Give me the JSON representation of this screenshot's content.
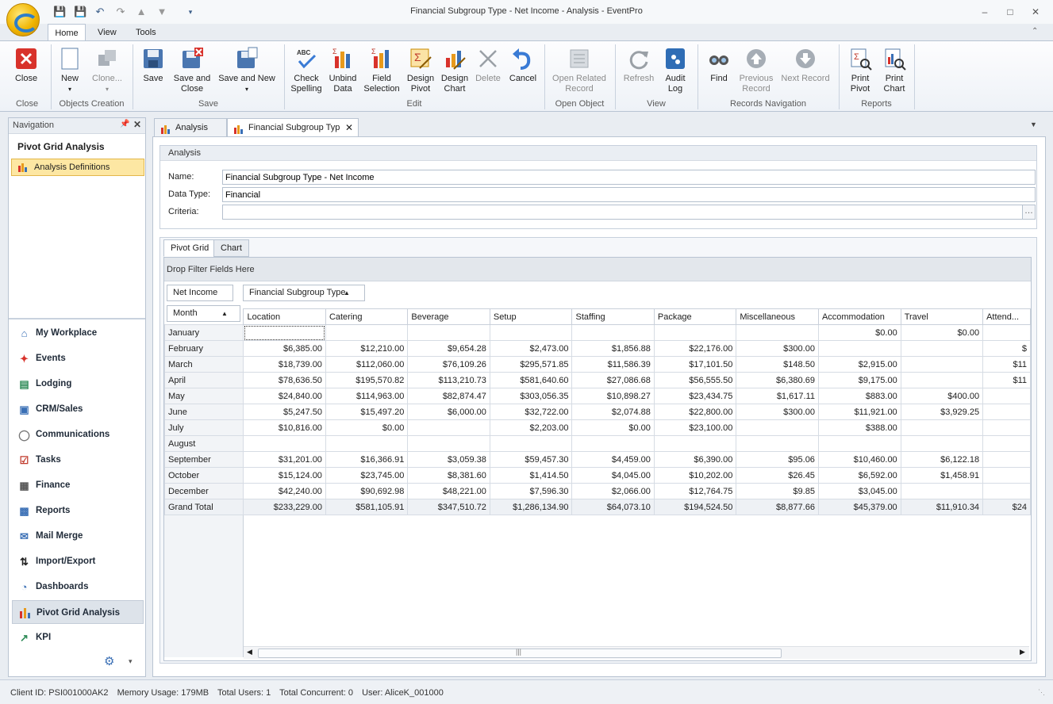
{
  "window": {
    "title": "Financial Subgroup Type - Net Income - Analysis - EventPro"
  },
  "ribbon_tabs": [
    "Home",
    "View",
    "Tools"
  ],
  "ribbon": {
    "close": "Close",
    "new": "New",
    "clone": "Clone...",
    "save": "Save",
    "save_and_close": [
      "Save and",
      "Close"
    ],
    "save_and_new": "Save and New",
    "check_spelling": [
      "Check",
      "Spelling"
    ],
    "unbind_data": [
      "Unbind",
      "Data"
    ],
    "field_selection": [
      "Field",
      "Selection"
    ],
    "design_pivot": [
      "Design",
      "Pivot"
    ],
    "design_chart": [
      "Design",
      "Chart"
    ],
    "delete": "Delete",
    "cancel": "Cancel",
    "open_related_record": [
      "Open Related",
      "Record"
    ],
    "refresh": "Refresh",
    "audit_log": [
      "Audit",
      "Log"
    ],
    "find": "Find",
    "previous_record": [
      "Previous",
      "Record"
    ],
    "next_record": "Next Record",
    "print_pivot": [
      "Print",
      "Pivot"
    ],
    "print_chart": [
      "Print",
      "Chart"
    ],
    "groups": [
      "Close",
      "Objects Creation",
      "Save",
      "Edit",
      "Open Object",
      "View",
      "Records Navigation",
      "Reports"
    ]
  },
  "navigation": {
    "header": "Navigation",
    "section_title": "Pivot Grid Analysis",
    "selected_item": "Analysis Definitions",
    "items": [
      "My Workplace",
      "Events",
      "Lodging",
      "CRM/Sales",
      "Communications",
      "Tasks",
      "Finance",
      "Reports",
      "Mail Merge",
      "Import/Export",
      "Dashboards",
      "Pivot Grid Analysis",
      "KPI"
    ]
  },
  "doc_tabs": [
    "Analysis",
    "Financial Subgroup Typ"
  ],
  "analysis": {
    "header": "Analysis",
    "name_label": "Name:",
    "name_value": "Financial Subgroup Type - Net Income",
    "data_type_label": "Data Type:",
    "data_type_value": "Financial",
    "criteria_label": "Criteria:",
    "criteria_value": ""
  },
  "pivot": {
    "tabs": [
      "Pivot Grid",
      "Chart"
    ],
    "filter_area": "Drop Filter Fields Here",
    "data_field": "Net Income",
    "column_field": "Financial Subgroup Type",
    "row_field": "Month",
    "columns": [
      "Location",
      "Catering",
      "Beverage",
      "Setup",
      "Staffing",
      "Package",
      "Miscellaneous",
      "Accommodation",
      "Travel",
      "Attend..."
    ],
    "rows": [
      {
        "month": "January",
        "values": [
          "",
          "",
          "",
          "",
          "",
          "",
          "",
          "$0.00",
          "$0.00",
          ""
        ]
      },
      {
        "month": "February",
        "values": [
          "$6,385.00",
          "$12,210.00",
          "$9,654.28",
          "$2,473.00",
          "$1,856.88",
          "$22,176.00",
          "$300.00",
          "",
          "",
          "$"
        ]
      },
      {
        "month": "March",
        "values": [
          "$18,739.00",
          "$112,060.00",
          "$76,109.26",
          "$295,571.85",
          "$11,586.39",
          "$17,101.50",
          "$148.50",
          "$2,915.00",
          "",
          "$11"
        ]
      },
      {
        "month": "April",
        "values": [
          "$78,636.50",
          "$195,570.82",
          "$113,210.73",
          "$581,640.60",
          "$27,086.68",
          "$56,555.50",
          "$6,380.69",
          "$9,175.00",
          "",
          "$11"
        ]
      },
      {
        "month": "May",
        "values": [
          "$24,840.00",
          "$114,963.00",
          "$82,874.47",
          "$303,056.35",
          "$10,898.27",
          "$23,434.75",
          "$1,617.11",
          "$883.00",
          "$400.00",
          ""
        ]
      },
      {
        "month": "June",
        "values": [
          "$5,247.50",
          "$15,497.20",
          "$6,000.00",
          "$32,722.00",
          "$2,074.88",
          "$22,800.00",
          "$300.00",
          "$11,921.00",
          "$3,929.25",
          ""
        ]
      },
      {
        "month": "July",
        "values": [
          "$10,816.00",
          "$0.00",
          "",
          "$2,203.00",
          "$0.00",
          "$23,100.00",
          "",
          "$388.00",
          "",
          ""
        ]
      },
      {
        "month": "August",
        "values": [
          "",
          "",
          "",
          "",
          "",
          "",
          "",
          "",
          "",
          ""
        ]
      },
      {
        "month": "September",
        "values": [
          "$31,201.00",
          "$16,366.91",
          "$3,059.38",
          "$59,457.30",
          "$4,459.00",
          "$6,390.00",
          "$95.06",
          "$10,460.00",
          "$6,122.18",
          ""
        ]
      },
      {
        "month": "October",
        "values": [
          "$15,124.00",
          "$23,745.00",
          "$8,381.60",
          "$1,414.50",
          "$4,045.00",
          "$10,202.00",
          "$26.45",
          "$6,592.00",
          "$1,458.91",
          ""
        ]
      },
      {
        "month": "December",
        "values": [
          "$42,240.00",
          "$90,692.98",
          "$48,221.00",
          "$7,596.30",
          "$2,066.00",
          "$12,764.75",
          "$9.85",
          "$3,045.00",
          "",
          ""
        ]
      }
    ],
    "grand_total_label": "Grand Total",
    "grand_total": [
      "$233,229.00",
      "$581,105.91",
      "$347,510.72",
      "$1,286,134.90",
      "$64,073.10",
      "$194,524.50",
      "$8,877.66",
      "$45,379.00",
      "$11,910.34",
      "$24"
    ]
  },
  "status": {
    "client_id": "Client ID: PSI001000AK2",
    "memory": "Memory Usage: 179MB",
    "total_users": "Total Users: 1",
    "total_concurrent": "Total Concurrent: 0",
    "user": "User: AliceK_001000"
  },
  "colors": {
    "accent": "#f0b400",
    "selected_nav": "#fde7a3",
    "ribbon_border": "#b8c4d3"
  },
  "icons": [
    "app-logo-icon",
    "save-icon",
    "undo-icon",
    "redo-icon",
    "close-icon",
    "pivot-icon",
    "chart-icon",
    "find-icon",
    "refresh-icon",
    "print-icon",
    "gear-icon"
  ]
}
